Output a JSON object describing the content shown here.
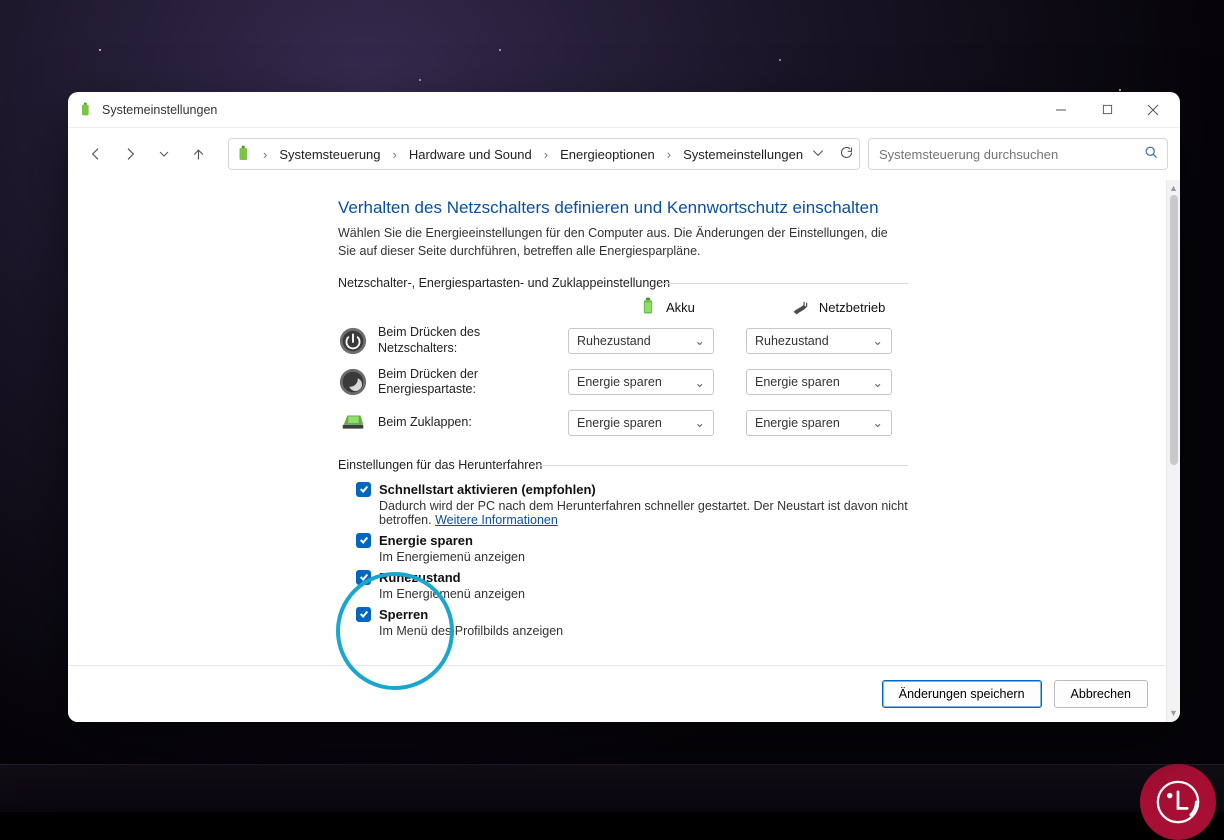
{
  "window": {
    "title": "Systemeinstellungen"
  },
  "breadcrumbs": {
    "level1": "Systemsteuerung",
    "level2": "Hardware und Sound",
    "level3": "Energieoptionen",
    "level4": "Systemeinstellungen"
  },
  "search": {
    "placeholder": "Systemsteuerung durchsuchen"
  },
  "page": {
    "title": "Verhalten des Netzschalters definieren und Kennwortschutz einschalten",
    "description": "Wählen Sie die Energieeinstellungen für den Computer aus. Die Änderungen der Einstellungen, die Sie auf dieser Seite durchführen, betreffen alle Energiesparpläne."
  },
  "section1_legend": "Netzschalter-, Energiespartasten- und Zuklappeinstellungen",
  "mode_cols": {
    "battery": "Akku",
    "ac": "Netzbetrieb"
  },
  "rows": {
    "power_button": {
      "label": "Beim Drücken des Netzschalters:",
      "battery": "Ruhezustand",
      "ac": "Ruhezustand"
    },
    "sleep_button": {
      "label": "Beim Drücken der Energiespartaste:",
      "battery": "Energie sparen",
      "ac": "Energie sparen"
    },
    "lid_close": {
      "label": "Beim Zuklappen:",
      "battery": "Energie sparen",
      "ac": "Energie sparen"
    }
  },
  "section2_legend": "Einstellungen für das Herunterfahren",
  "shutdown": {
    "fast_start": {
      "title": "Schnellstart aktivieren (empfohlen)",
      "desc_a": "Dadurch wird der PC nach dem Herunterfahren schneller gestartet. Der Neustart ist davon nicht betroffen. ",
      "link": "Weitere Informationen"
    },
    "sleep": {
      "title": "Energie sparen",
      "desc": "Im Energiemenü anzeigen"
    },
    "hibernate": {
      "title": "Ruhezustand",
      "desc": "Im Energiemenü anzeigen"
    },
    "lock": {
      "title": "Sperren",
      "desc": "Im Menü des Profilbilds anzeigen"
    }
  },
  "buttons": {
    "save": "Änderungen speichern",
    "cancel": "Abbrechen"
  }
}
